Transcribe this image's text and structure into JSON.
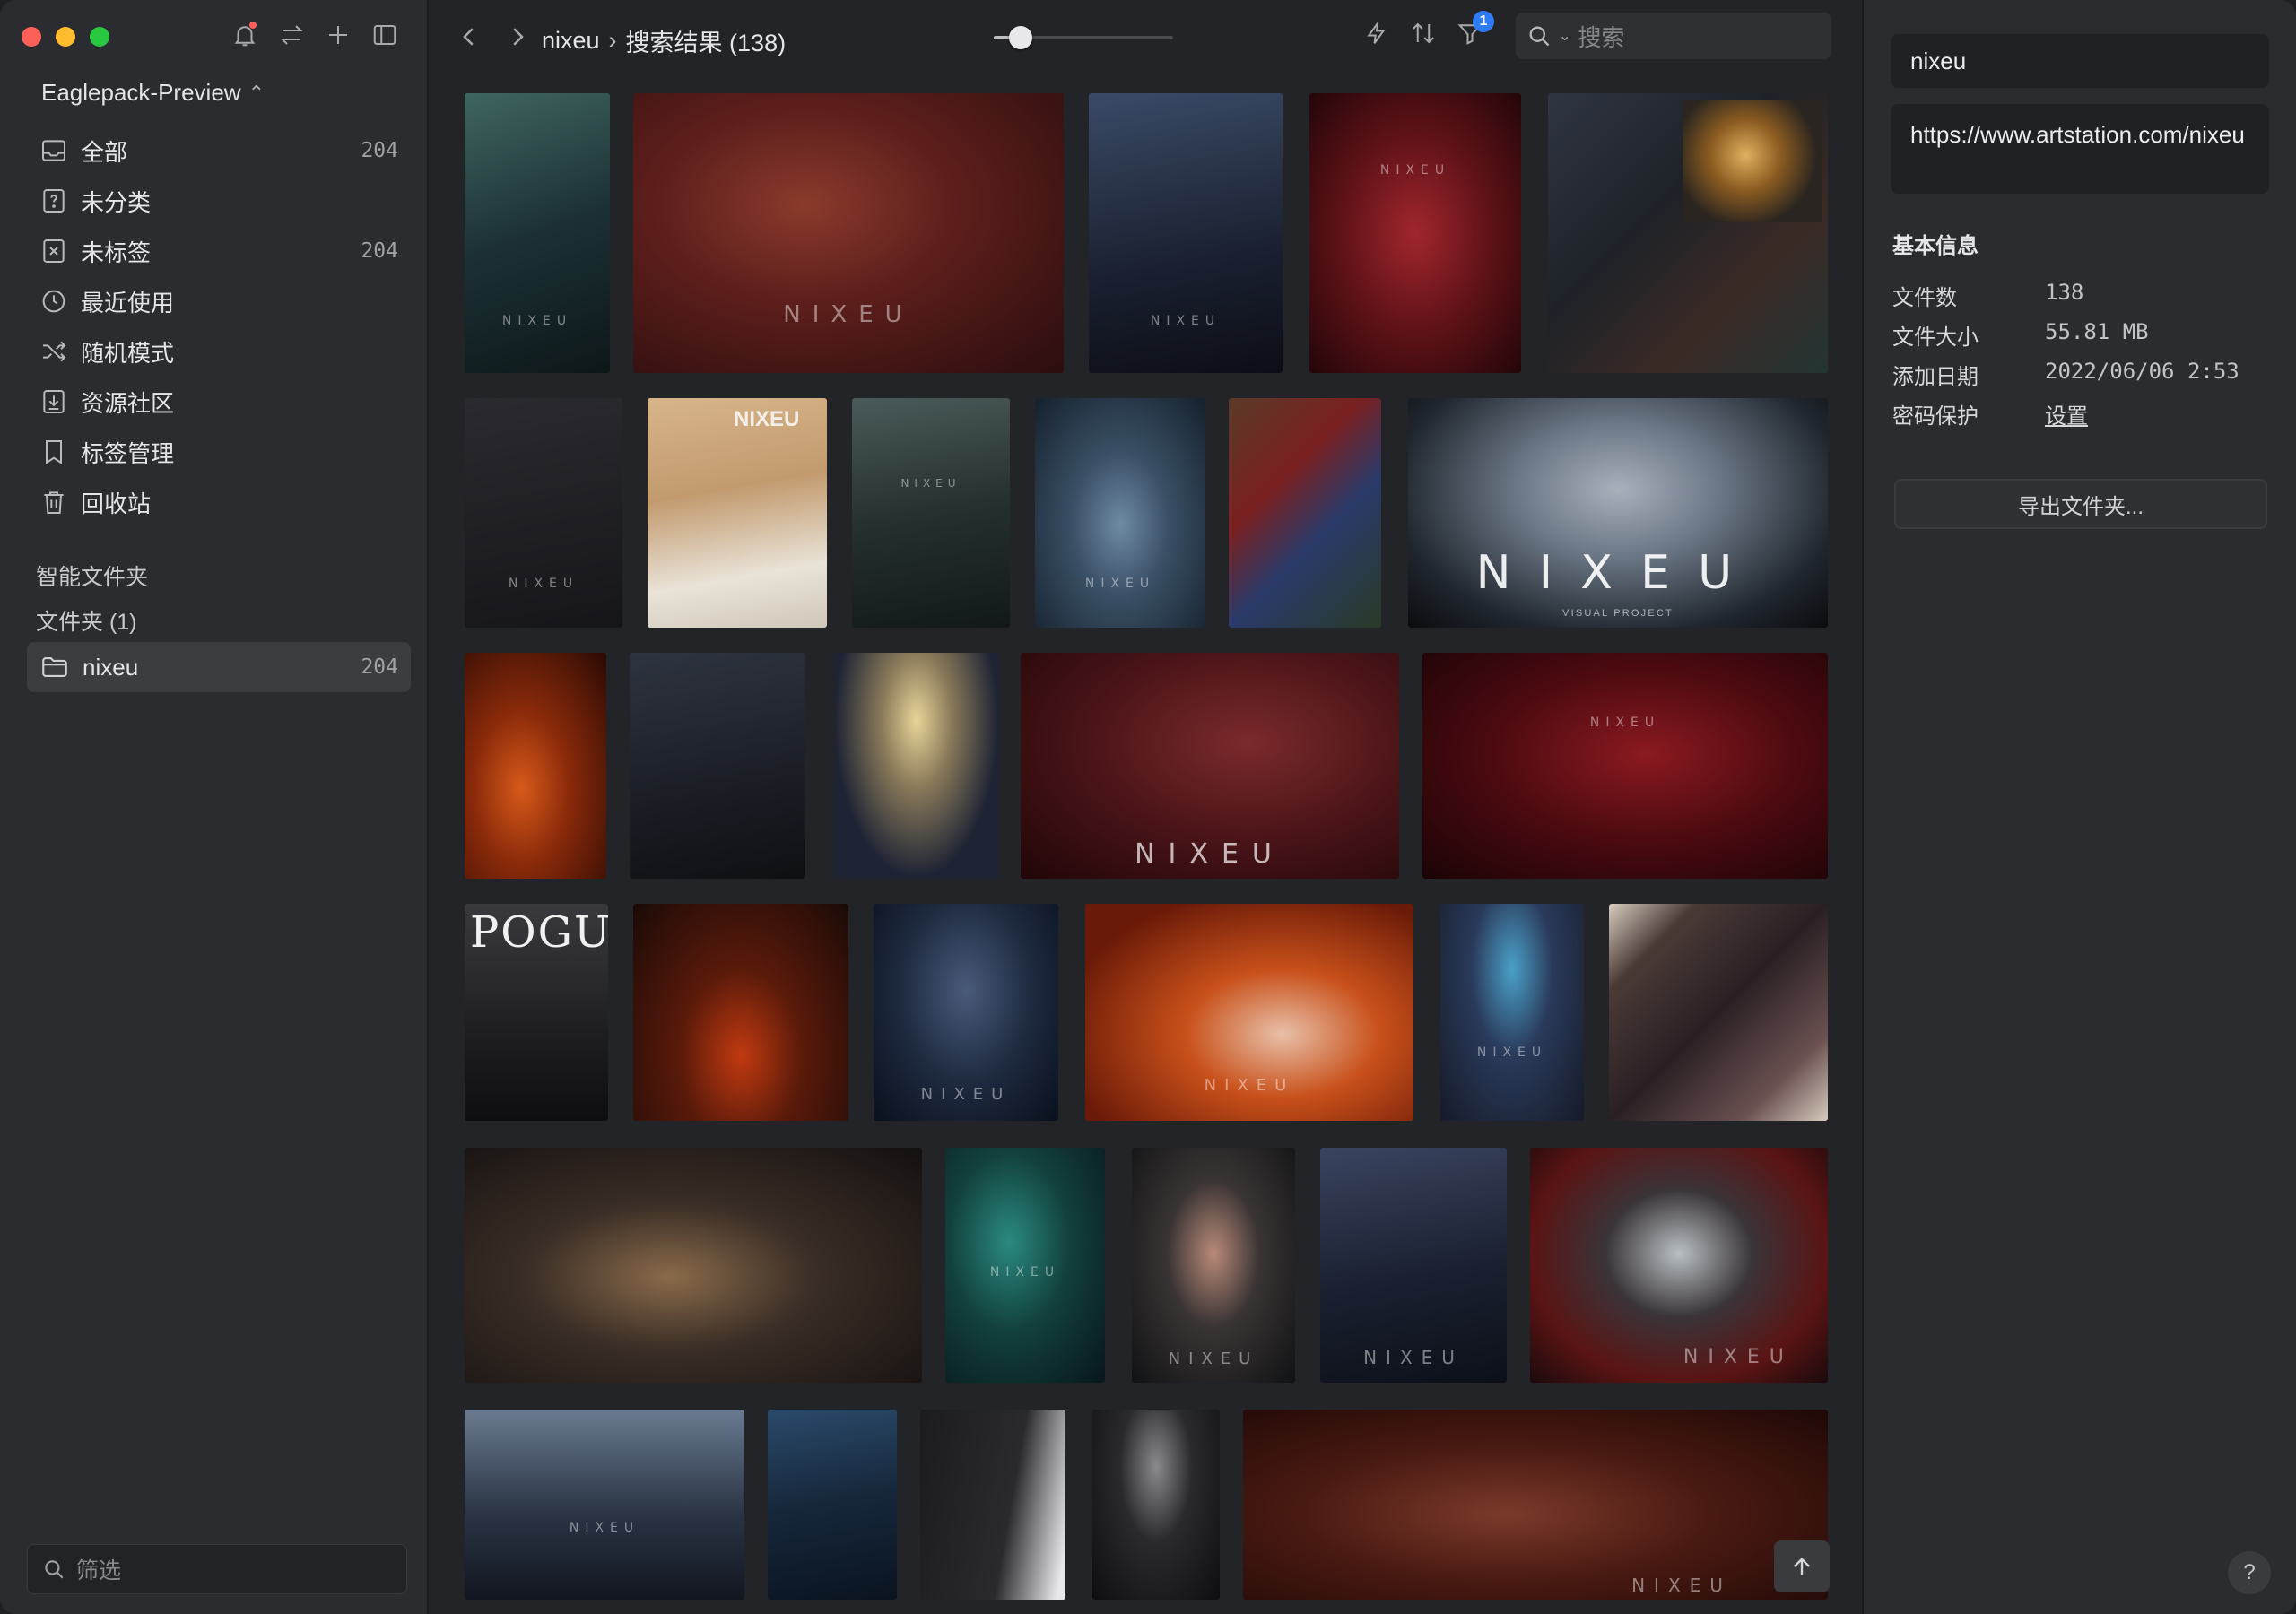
{
  "sidebar": {
    "library_name": "Eaglepack-Preview",
    "nav": [
      {
        "label": "全部",
        "count": "204",
        "icon": "inbox-icon"
      },
      {
        "label": "未分类",
        "count": "",
        "icon": "question-box-icon"
      },
      {
        "label": "未标签",
        "count": "204",
        "icon": "untagged-icon"
      },
      {
        "label": "最近使用",
        "count": "",
        "icon": "clock-icon"
      },
      {
        "label": "随机模式",
        "count": "",
        "icon": "shuffle-icon"
      },
      {
        "label": "资源社区",
        "count": "",
        "icon": "download-box-icon"
      },
      {
        "label": "标签管理",
        "count": "",
        "icon": "bookmark-icon"
      },
      {
        "label": "回收站",
        "count": "",
        "icon": "trash-icon"
      }
    ],
    "smart_folders_label": "智能文件夹",
    "folders_label": "文件夹 (1)",
    "folder": {
      "name": "nixeu",
      "count": "204"
    },
    "filter_placeholder": "筛选"
  },
  "toolbar": {
    "breadcrumb_folder": "nixeu",
    "breadcrumb_separator": "›",
    "breadcrumb_result": "搜索结果 (138)",
    "zoom_level": 0.15,
    "filter_badge": "1",
    "search_placeholder": "搜索"
  },
  "watermark_text": "NIXEU",
  "visual_project_text": "VISUAL PROJECT",
  "poster_text": "POGUL",
  "cap_text": "NIXEU",
  "inspector": {
    "name": "nixeu",
    "url": "https://www.artstation.com/nixeu",
    "info_title": "基本信息",
    "rows": [
      {
        "k": "文件数",
        "v": "138"
      },
      {
        "k": "文件大小",
        "v": "55.81 MB"
      },
      {
        "k": "添加日期",
        "v": "2022/06/06 2:53"
      },
      {
        "k": "密码保护",
        "v": "设置"
      }
    ],
    "export_label": "导出文件夹...",
    "help_label": "?"
  },
  "colors": {
    "accent": "#2d7cf6",
    "selected": "#3c3d41"
  }
}
